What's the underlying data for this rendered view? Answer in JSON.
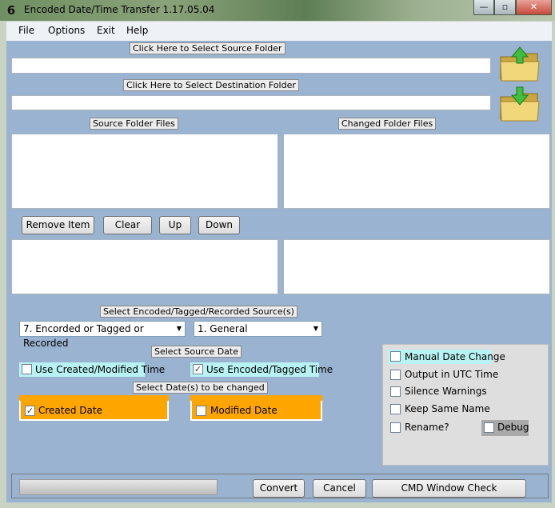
{
  "window": {
    "title": "Encoded Date/Time Transfer 1.17.05.04",
    "app_icon_glyph": "6",
    "minimize_glyph": "—",
    "maximize_glyph": "▫",
    "close_glyph": "✕"
  },
  "menu": [
    "File",
    "Options",
    "Exit",
    "Help"
  ],
  "source_folder": {
    "button_label": "Click Here to Select Source Folder",
    "path_value": "",
    "icon": "folder-up-arrow-icon"
  },
  "destination_folder": {
    "button_label": "Click Here to Select Destination Folder",
    "path_value": "",
    "icon": "folder-down-arrow-icon"
  },
  "lists": {
    "source_label": "Source Folder Files",
    "changed_label": "Changed Folder Files"
  },
  "list_buttons": {
    "remove": "Remove Item",
    "clear": "Clear",
    "up": "Up",
    "down": "Down"
  },
  "source_select": {
    "label": "Select Encoded/Tagged/Recorded Source(s)",
    "dropdown1_value": "7.  Encorded or Tagged or Recorded",
    "dropdown2_value": "1.  General"
  },
  "source_date": {
    "label": "Select Source Date",
    "use_created_modified": {
      "label": "Use Created/Modified Time",
      "checked": false
    },
    "use_encoded_tagged": {
      "label": "Use Encoded/Tagged Time",
      "checked": true
    }
  },
  "dates_to_change": {
    "label": "Select Date(s) to be changed",
    "created_date": {
      "label": "Created Date",
      "checked": true
    },
    "modified_date": {
      "label": "Modified Date",
      "checked": false
    }
  },
  "options_panel": {
    "manual_date_change": {
      "label": "Manual Date Change",
      "checked": false
    },
    "output_utc": {
      "label": "Output in UTC Time",
      "checked": false
    },
    "silence_warnings": {
      "label": "Silence Warnings",
      "checked": false
    },
    "keep_same_name": {
      "label": "Keep Same Name",
      "checked": false
    },
    "rename": {
      "label": "Rename?",
      "checked": false
    },
    "debug": {
      "label": "Debug",
      "checked": false
    }
  },
  "bottom": {
    "convert": "Convert",
    "cancel": "Cancel",
    "cmd_check": "CMD Window Check"
  },
  "check_glyph": "✓",
  "colors": {
    "client_bg": "#99b3d1",
    "orange": "#ffa500",
    "cyan_label": "#b8f2f2"
  }
}
